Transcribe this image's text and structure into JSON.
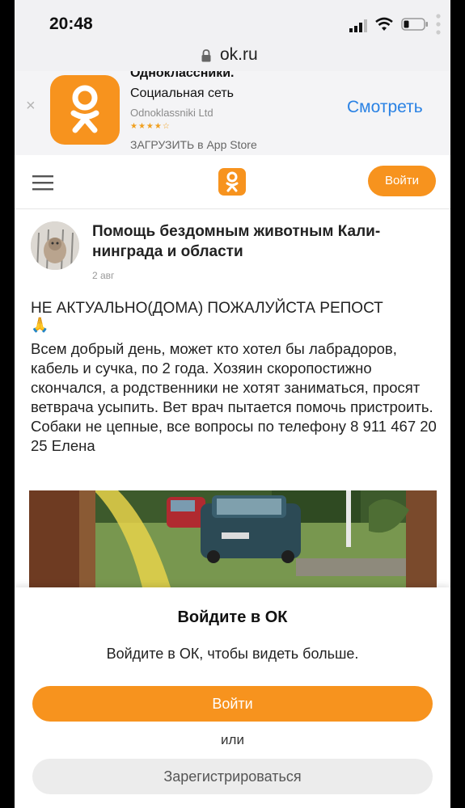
{
  "status_bar": {
    "time": "20:48"
  },
  "browser": {
    "url": "ok.ru"
  },
  "app_banner": {
    "app_name": "Одноклассники.",
    "subtitle": "Социальная сеть",
    "developer": "Odnoklassniki Ltd",
    "stars": "★★★★☆",
    "download": "ЗАГРУЗИТЬ в App Store",
    "view_label": "Смотреть",
    "close_symbol": "×"
  },
  "header": {
    "login_label": "Войти"
  },
  "post": {
    "group_name": "Помощь бездомным животным Кали- нинграда и области",
    "date": "2 авг",
    "title": "НЕ АКТУАЛЬНО(ДОМА) ПОЖАЛУЙСТА РЕПОСТ",
    "emoji": "🙏",
    "body": "Всем добрый день, может кто хотел бы лабрадоров, кабель и сучка, по 2 года. Хозяин скоропостижно скончался, а родственники не хотят заниматься, просят ветврача усыпить. Вет врач пытается помочь пристроить. Собаки не цепные, все вопросы по телефону 8 911 467 20 25 Елена"
  },
  "login_sheet": {
    "title": "Войдите в ОК",
    "subtitle": "Войдите в ОК, чтобы видеть больше.",
    "login_label": "Войти",
    "or_label": "или",
    "register_label": "Зарегистрироваться"
  },
  "colors": {
    "brand": "#f7931e",
    "link": "#2a82e4"
  }
}
